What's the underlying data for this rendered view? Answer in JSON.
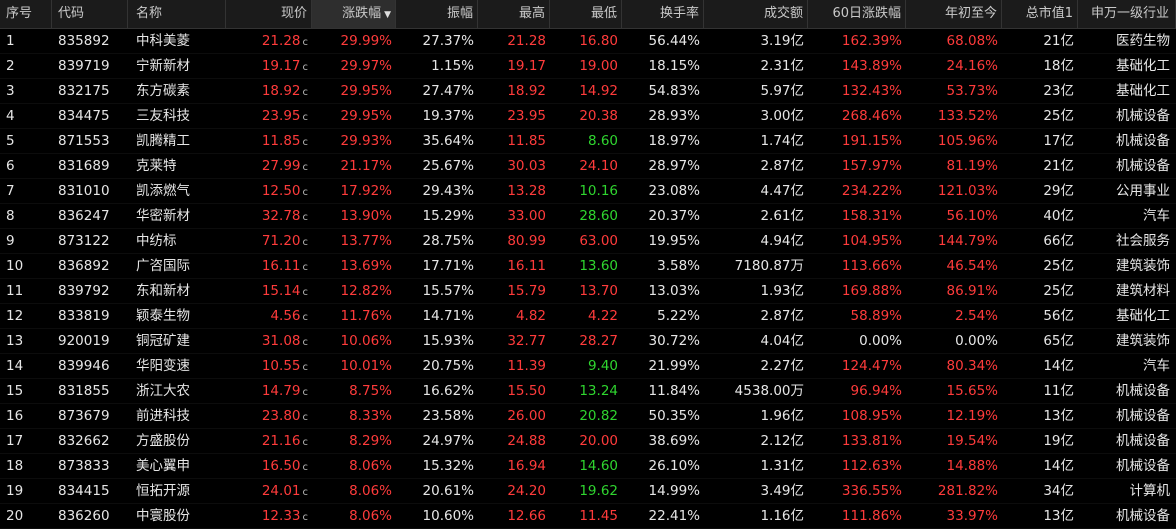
{
  "headers": {
    "idx": "序号",
    "code": "代码",
    "name": "名称",
    "price": "现价",
    "pct": "涨跌幅",
    "amp": "振幅",
    "high": "最高",
    "low": "最低",
    "turn": "换手率",
    "vol": "成交额",
    "d60": "60日涨跌幅",
    "ytd": "年初至今",
    "cap": "总市值1",
    "ind": "申万一级行业"
  },
  "sort_icon": "▼",
  "price_tag": "c",
  "colors": {
    "up": "#ff3b3b",
    "down": "#2fd52f",
    "flat": "#e6e6e6"
  },
  "rows": [
    {
      "idx": "1",
      "code": "835892",
      "name": "中科美菱",
      "price": "21.28",
      "pct": "29.99%",
      "amp": "27.37%",
      "high": "21.28",
      "low": "16.80",
      "turn": "56.44%",
      "vol": "3.19亿",
      "d60": "162.39%",
      "ytd": "68.08%",
      "cap": "21亿",
      "ind": "医药生物",
      "low_dir": "up",
      "d60_dir": "up",
      "ytd_dir": "up"
    },
    {
      "idx": "2",
      "code": "839719",
      "name": "宁新新材",
      "price": "19.17",
      "pct": "29.97%",
      "amp": "1.15%",
      "high": "19.17",
      "low": "19.00",
      "turn": "18.15%",
      "vol": "2.31亿",
      "d60": "143.89%",
      "ytd": "24.16%",
      "cap": "18亿",
      "ind": "基础化工",
      "low_dir": "up",
      "d60_dir": "up",
      "ytd_dir": "up"
    },
    {
      "idx": "3",
      "code": "832175",
      "name": "东方碳素",
      "price": "18.92",
      "pct": "29.95%",
      "amp": "27.47%",
      "high": "18.92",
      "low": "14.92",
      "turn": "54.83%",
      "vol": "5.97亿",
      "d60": "132.43%",
      "ytd": "53.73%",
      "cap": "23亿",
      "ind": "基础化工",
      "low_dir": "up",
      "d60_dir": "up",
      "ytd_dir": "up"
    },
    {
      "idx": "4",
      "code": "834475",
      "name": "三友科技",
      "price": "23.95",
      "pct": "29.95%",
      "amp": "19.37%",
      "high": "23.95",
      "low": "20.38",
      "turn": "28.93%",
      "vol": "3.00亿",
      "d60": "268.46%",
      "ytd": "133.52%",
      "cap": "25亿",
      "ind": "机械设备",
      "low_dir": "up",
      "d60_dir": "up",
      "ytd_dir": "up"
    },
    {
      "idx": "5",
      "code": "871553",
      "name": "凯腾精工",
      "price": "11.85",
      "pct": "29.93%",
      "amp": "35.64%",
      "high": "11.85",
      "low": "8.60",
      "turn": "18.97%",
      "vol": "1.74亿",
      "d60": "191.15%",
      "ytd": "105.96%",
      "cap": "17亿",
      "ind": "机械设备",
      "low_dir": "down",
      "d60_dir": "up",
      "ytd_dir": "up"
    },
    {
      "idx": "6",
      "code": "831689",
      "name": "克莱特",
      "price": "27.99",
      "pct": "21.17%",
      "amp": "25.67%",
      "high": "30.03",
      "low": "24.10",
      "turn": "28.97%",
      "vol": "2.87亿",
      "d60": "157.97%",
      "ytd": "81.19%",
      "cap": "21亿",
      "ind": "机械设备",
      "low_dir": "up",
      "d60_dir": "up",
      "ytd_dir": "up"
    },
    {
      "idx": "7",
      "code": "831010",
      "name": "凯添燃气",
      "price": "12.50",
      "pct": "17.92%",
      "amp": "29.43%",
      "high": "13.28",
      "low": "10.16",
      "turn": "23.08%",
      "vol": "4.47亿",
      "d60": "234.22%",
      "ytd": "121.03%",
      "cap": "29亿",
      "ind": "公用事业",
      "low_dir": "down",
      "d60_dir": "up",
      "ytd_dir": "up"
    },
    {
      "idx": "8",
      "code": "836247",
      "name": "华密新材",
      "price": "32.78",
      "pct": "13.90%",
      "amp": "15.29%",
      "high": "33.00",
      "low": "28.60",
      "turn": "20.37%",
      "vol": "2.61亿",
      "d60": "158.31%",
      "ytd": "56.10%",
      "cap": "40亿",
      "ind": "汽车",
      "low_dir": "down",
      "d60_dir": "up",
      "ytd_dir": "up"
    },
    {
      "idx": "9",
      "code": "873122",
      "name": "中纺标",
      "price": "71.20",
      "pct": "13.77%",
      "amp": "28.75%",
      "high": "80.99",
      "low": "63.00",
      "turn": "19.95%",
      "vol": "4.94亿",
      "d60": "104.95%",
      "ytd": "144.79%",
      "cap": "66亿",
      "ind": "社会服务",
      "low_dir": "up",
      "d60_dir": "up",
      "ytd_dir": "up"
    },
    {
      "idx": "10",
      "code": "836892",
      "name": "广咨国际",
      "price": "16.11",
      "pct": "13.69%",
      "amp": "17.71%",
      "high": "16.11",
      "low": "13.60",
      "turn": "3.58%",
      "vol": "7180.87万",
      "d60": "113.66%",
      "ytd": "46.54%",
      "cap": "25亿",
      "ind": "建筑装饰",
      "low_dir": "down",
      "d60_dir": "up",
      "ytd_dir": "up"
    },
    {
      "idx": "11",
      "code": "839792",
      "name": "东和新材",
      "price": "15.14",
      "pct": "12.82%",
      "amp": "15.57%",
      "high": "15.79",
      "low": "13.70",
      "turn": "13.03%",
      "vol": "1.93亿",
      "d60": "169.88%",
      "ytd": "86.91%",
      "cap": "25亿",
      "ind": "建筑材料",
      "low_dir": "up",
      "d60_dir": "up",
      "ytd_dir": "up"
    },
    {
      "idx": "12",
      "code": "833819",
      "name": "颖泰生物",
      "price": "4.56",
      "pct": "11.76%",
      "amp": "14.71%",
      "high": "4.82",
      "low": "4.22",
      "turn": "5.22%",
      "vol": "2.87亿",
      "d60": "58.89%",
      "ytd": "2.54%",
      "cap": "56亿",
      "ind": "基础化工",
      "low_dir": "up",
      "d60_dir": "up",
      "ytd_dir": "up"
    },
    {
      "idx": "13",
      "code": "920019",
      "name": "铜冠矿建",
      "price": "31.08",
      "pct": "10.06%",
      "amp": "15.93%",
      "high": "32.77",
      "low": "28.27",
      "turn": "30.72%",
      "vol": "4.04亿",
      "d60": "0.00%",
      "ytd": "0.00%",
      "cap": "65亿",
      "ind": "建筑装饰",
      "low_dir": "up",
      "d60_dir": "flat",
      "ytd_dir": "flat"
    },
    {
      "idx": "14",
      "code": "839946",
      "name": "华阳变速",
      "price": "10.55",
      "pct": "10.01%",
      "amp": "20.75%",
      "high": "11.39",
      "low": "9.40",
      "turn": "21.99%",
      "vol": "2.27亿",
      "d60": "124.47%",
      "ytd": "80.34%",
      "cap": "14亿",
      "ind": "汽车",
      "low_dir": "down",
      "d60_dir": "up",
      "ytd_dir": "up"
    },
    {
      "idx": "15",
      "code": "831855",
      "name": "浙江大农",
      "price": "14.79",
      "pct": "8.75%",
      "amp": "16.62%",
      "high": "15.50",
      "low": "13.24",
      "turn": "11.84%",
      "vol": "4538.00万",
      "d60": "96.94%",
      "ytd": "15.65%",
      "cap": "11亿",
      "ind": "机械设备",
      "low_dir": "down",
      "d60_dir": "up",
      "ytd_dir": "up"
    },
    {
      "idx": "16",
      "code": "873679",
      "name": "前进科技",
      "price": "23.80",
      "pct": "8.33%",
      "amp": "23.58%",
      "high": "26.00",
      "low": "20.82",
      "turn": "50.35%",
      "vol": "1.96亿",
      "d60": "108.95%",
      "ytd": "12.19%",
      "cap": "13亿",
      "ind": "机械设备",
      "low_dir": "down",
      "d60_dir": "up",
      "ytd_dir": "up"
    },
    {
      "idx": "17",
      "code": "832662",
      "name": "方盛股份",
      "price": "21.16",
      "pct": "8.29%",
      "amp": "24.97%",
      "high": "24.88",
      "low": "20.00",
      "turn": "38.69%",
      "vol": "2.12亿",
      "d60": "133.81%",
      "ytd": "19.54%",
      "cap": "19亿",
      "ind": "机械设备",
      "low_dir": "up",
      "d60_dir": "up",
      "ytd_dir": "up"
    },
    {
      "idx": "18",
      "code": "873833",
      "name": "美心翼申",
      "price": "16.50",
      "pct": "8.06%",
      "amp": "15.32%",
      "high": "16.94",
      "low": "14.60",
      "turn": "26.10%",
      "vol": "1.31亿",
      "d60": "112.63%",
      "ytd": "14.88%",
      "cap": "14亿",
      "ind": "机械设备",
      "low_dir": "down",
      "d60_dir": "up",
      "ytd_dir": "up"
    },
    {
      "idx": "19",
      "code": "834415",
      "name": "恒拓开源",
      "price": "24.01",
      "pct": "8.06%",
      "amp": "20.61%",
      "high": "24.20",
      "low": "19.62",
      "turn": "14.99%",
      "vol": "3.49亿",
      "d60": "336.55%",
      "ytd": "281.82%",
      "cap": "34亿",
      "ind": "计算机",
      "low_dir": "down",
      "d60_dir": "up",
      "ytd_dir": "up"
    },
    {
      "idx": "20",
      "code": "836260",
      "name": "中寰股份",
      "price": "12.33",
      "pct": "8.06%",
      "amp": "10.60%",
      "high": "12.66",
      "low": "11.45",
      "turn": "22.41%",
      "vol": "1.16亿",
      "d60": "111.86%",
      "ytd": "33.97%",
      "cap": "13亿",
      "ind": "机械设备",
      "low_dir": "up",
      "d60_dir": "up",
      "ytd_dir": "up"
    }
  ]
}
